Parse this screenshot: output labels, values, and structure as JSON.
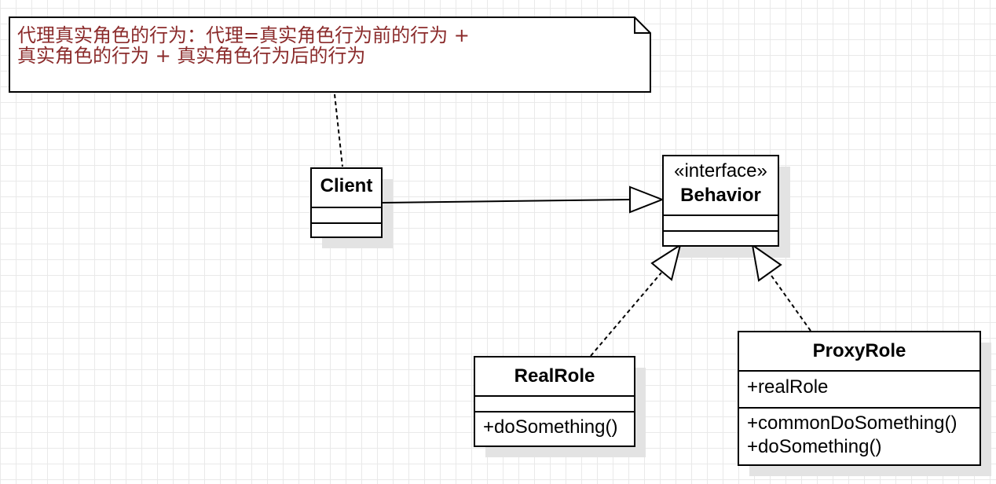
{
  "note": {
    "line1": "代理真实角色的行为：代理=真实角色行为前的行为 +",
    "line2": "真实角色的行为 + 真实角色行为后的行为"
  },
  "client": {
    "name": "Client"
  },
  "behavior": {
    "stereotype": "«interface»",
    "name": "Behavior"
  },
  "real_role": {
    "name": "RealRole",
    "methods": [
      "+doSomething()"
    ]
  },
  "proxy_role": {
    "name": "ProxyRole",
    "attributes": [
      "+realRole"
    ],
    "methods": [
      "+commonDoSomething()",
      "+doSomething()"
    ]
  }
}
